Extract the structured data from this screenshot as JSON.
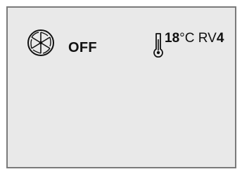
{
  "display": {
    "fan_icon": "fan-icon",
    "thermometer_icon": "thermometer-icon",
    "status": "OFF",
    "temperature_value": "18",
    "temperature_unit": "°C",
    "rv_label": "RV",
    "rv_value": "4",
    "colors": {
      "screen_bg": "#e9e9e9",
      "border": "#7a7a7a",
      "text": "#111111"
    }
  }
}
